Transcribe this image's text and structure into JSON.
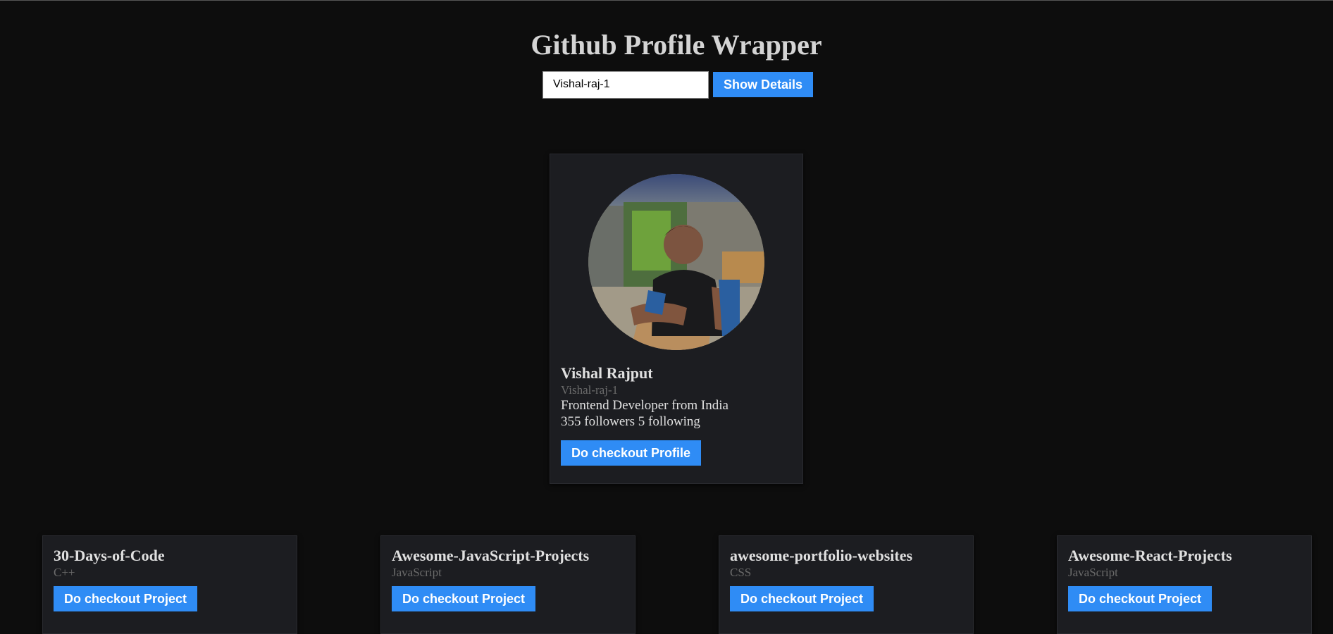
{
  "header": {
    "title": "Github Profile Wrapper"
  },
  "search": {
    "value": "Vishal-raj-1",
    "button_label": "Show Details"
  },
  "profile": {
    "name": "Vishal Rajput",
    "login": "Vishal-raj-1",
    "bio": "Frontend Developer from India",
    "stats": "355 followers 5 following",
    "button_label": "Do checkout Profile"
  },
  "repos": [
    {
      "name": "30-Days-of-Code",
      "language": "C++",
      "button_label": "Do checkout Project"
    },
    {
      "name": "Awesome-JavaScript-Projects",
      "language": "JavaScript",
      "button_label": "Do checkout Project"
    },
    {
      "name": "awesome-portfolio-websites",
      "language": "CSS",
      "button_label": "Do checkout Project"
    },
    {
      "name": "Awesome-React-Projects",
      "language": "JavaScript",
      "button_label": "Do checkout Project"
    }
  ],
  "colors": {
    "background": "#0d0d0d",
    "card": "#1c1d21",
    "accent": "#2f8cf5",
    "muted_text": "#6b6b6b"
  }
}
